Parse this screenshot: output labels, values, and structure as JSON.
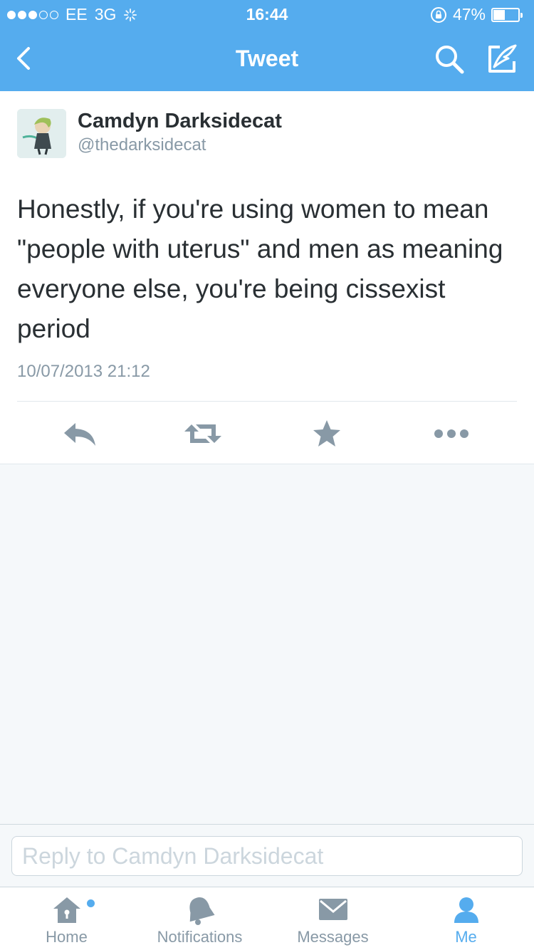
{
  "status_bar": {
    "carrier": "EE",
    "network": "3G",
    "time": "16:44",
    "battery_percent_label": "47%",
    "battery_level": 0.47,
    "signal_bars_filled": 3,
    "signal_bars_total": 5
  },
  "nav": {
    "title": "Tweet",
    "back_icon": "chevron-left-icon",
    "search_icon": "search-icon",
    "compose_icon": "compose-icon"
  },
  "tweet": {
    "author_name": "Camdyn Darksidecat",
    "author_handle": "@thedarksidecat",
    "text": "Honestly, if you're using women to mean \"people with uterus\" and men as meaning everyone else, you're being cissexist period",
    "timestamp": "10/07/2013 21:12",
    "actions": [
      "reply-icon",
      "retweet-icon",
      "favorite-icon",
      "more-icon"
    ]
  },
  "reply": {
    "placeholder": "Reply to Camdyn Darksidecat"
  },
  "tabs": [
    {
      "label": "Home",
      "icon": "home-icon",
      "active": false,
      "has_dot": true
    },
    {
      "label": "Notifications",
      "icon": "bell-icon",
      "active": false,
      "has_dot": false
    },
    {
      "label": "Messages",
      "icon": "envelope-icon",
      "active": false,
      "has_dot": false
    },
    {
      "label": "Me",
      "icon": "person-icon",
      "active": true,
      "has_dot": false
    }
  ],
  "colors": {
    "brand": "#55acee",
    "text": "#292f33",
    "muted": "#8899a6",
    "background": "#f5f8fa"
  }
}
